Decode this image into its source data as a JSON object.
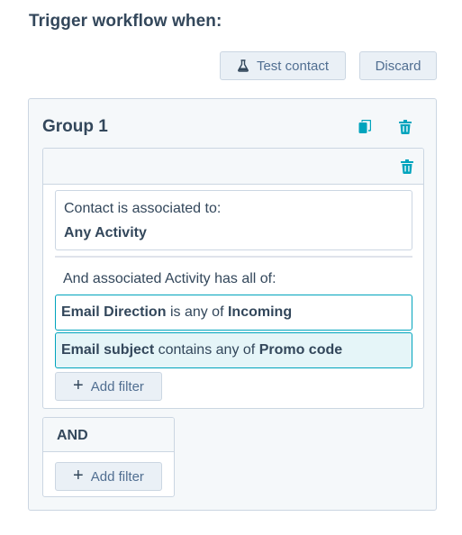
{
  "header": {
    "title": "Trigger workflow when:"
  },
  "toolbar": {
    "test_contact_label": "Test contact",
    "test_contact_icon": "flask-icon",
    "discard_label": "Discard"
  },
  "group": {
    "title": "Group 1",
    "icons": [
      "copy-icon",
      "trash-icon"
    ],
    "filter_card": {
      "association_label": "Contact is associated to:",
      "association_value": "Any Activity",
      "associated_condition_intro": "And associated Activity has all of:",
      "conditions": [
        {
          "property": "Email Direction",
          "operator": "is any of",
          "value": "Incoming",
          "highlighted": false
        },
        {
          "property": "Email subject",
          "operator": "contains any of",
          "value": "Promo code",
          "highlighted": true
        }
      ],
      "add_filter_label": "Add filter"
    },
    "and_block": {
      "label": "AND",
      "add_filter_label": "Add filter"
    }
  },
  "colors": {
    "text": "#33475b",
    "border": "#cbd6e2",
    "accent_teal": "#00a4bd",
    "highlight_bg": "#e5f5f8",
    "button_bg": "#eaf0f6",
    "panel_bg": "#f5f8fa"
  }
}
